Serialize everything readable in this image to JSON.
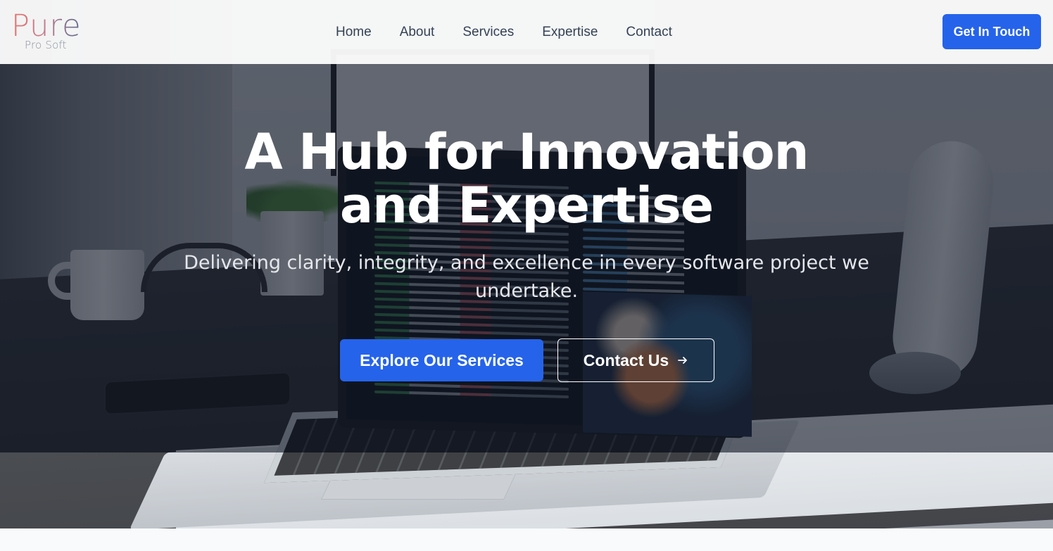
{
  "brand": {
    "name": "Pure",
    "tagline": "Pro Soft"
  },
  "nav": {
    "items": [
      {
        "label": "Home"
      },
      {
        "label": "About"
      },
      {
        "label": "Services"
      },
      {
        "label": "Expertise"
      },
      {
        "label": "Contact"
      }
    ],
    "cta_label": "Get In Touch"
  },
  "hero": {
    "title_line1": "A Hub for Innovation",
    "title_line2": "and Expertise",
    "subtitle_line1": "Delivering clarity, integrity, and excellence in every software project we",
    "subtitle_line2": "undertake.",
    "primary_button": "Explore Our Services",
    "secondary_button": "Contact Us",
    "secondary_button_icon": "arrow-right-icon"
  },
  "colors": {
    "accent": "#2563eb",
    "nav_text": "#344256",
    "overlay": "#111827",
    "logo_gradient_start": "#e8736c",
    "logo_gradient_end": "#5b6b8f"
  }
}
